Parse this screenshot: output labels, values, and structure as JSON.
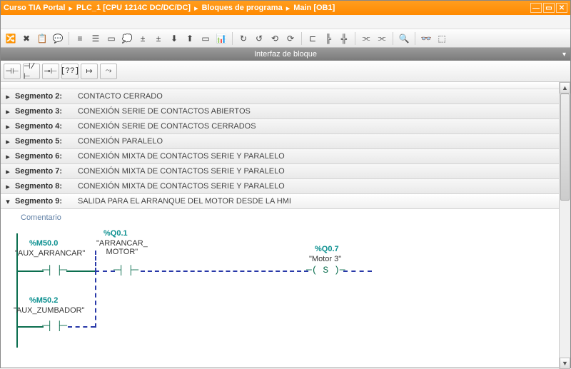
{
  "breadcrumb": [
    "Curso TIA Portal",
    "PLC_1 [CPU 1214C DC/DC/DC]",
    "Bloques de programa",
    "Main [OB1]"
  ],
  "interface_label": "Interfaz de bloque",
  "ladder_palette": [
    "⊣⊢",
    "⊣/⊢",
    "⊸⊢",
    "[??]",
    "↦",
    "⤳"
  ],
  "segments": [
    {
      "n": "Segmento 2:",
      "d": "CONTACTO CERRADO"
    },
    {
      "n": "Segmento 3:",
      "d": "CONEXIÓN SERIE DE CONTACTOS ABIERTOS"
    },
    {
      "n": "Segmento 4:",
      "d": "CONEXIÓN SERIE DE CONTACTOS CERRADOS"
    },
    {
      "n": "Segmento 5:",
      "d": "CONEXIÓN PARALELO"
    },
    {
      "n": "Segmento 6:",
      "d": "CONEXIÓN MIXTA DE CONTACTOS SERIE Y PARALELO"
    },
    {
      "n": "Segmento 7:",
      "d": "CONEXIÓN MIXTA DE CONTACTOS SERIE Y PARALELO"
    },
    {
      "n": "Segmento 8:",
      "d": "CONEXIÓN MIXTA DE CONTACTOS SERIE Y PARALELO"
    }
  ],
  "open_segment": {
    "n": "Segmento 9:",
    "d": "SALIDA PARA EL ARRANQUE DEL MOTOR DESDE LA HMI"
  },
  "comment_label": "Comentario",
  "net": {
    "c1_addr": "%M50.0",
    "c1_sym": "\"AUX_ARRANCAR\"",
    "c2_addr": "%Q0.1",
    "c2_sym": "\"ARRANCAR_\nMOTOR\"",
    "out_addr": "%Q0.7",
    "out_sym": "\"Motor 3\"",
    "c3_addr": "%M50.2",
    "c3_sym": "\"AUX_ZUMBADOR\""
  },
  "coil_glyph": "─( S )─",
  "contact_glyph": "─┤ ├─"
}
